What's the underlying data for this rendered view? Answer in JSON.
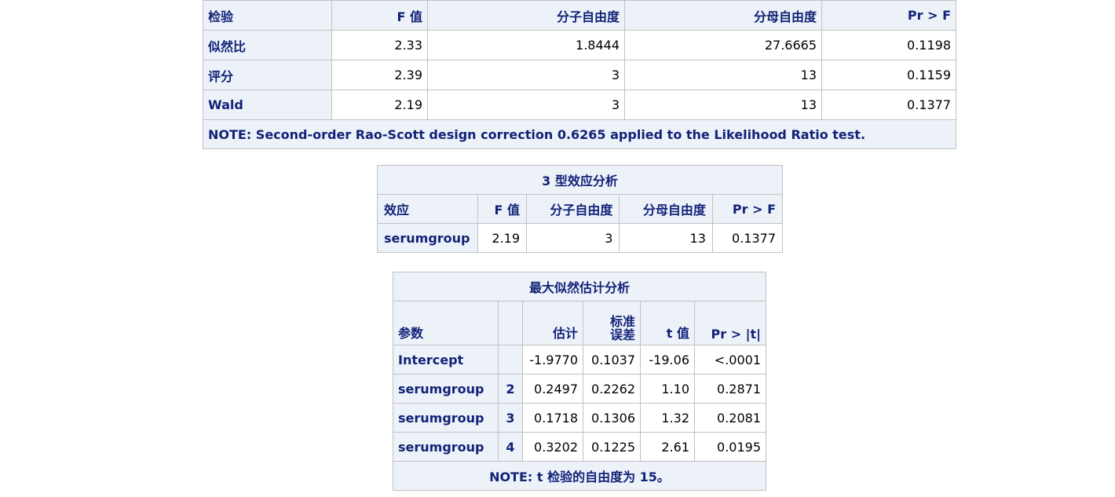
{
  "table_test": {
    "headers": [
      "检验",
      "F 值",
      "分子自由度",
      "分母自由度",
      "Pr > F"
    ],
    "rows": [
      [
        "似然比",
        "2.33",
        "1.8444",
        "27.6665",
        "0.1198"
      ],
      [
        "评分",
        "2.39",
        "3",
        "13",
        "0.1159"
      ],
      [
        "Wald",
        "2.19",
        "3",
        "13",
        "0.1377"
      ]
    ],
    "note": "NOTE: Second-order Rao-Scott design correction 0.6265 applied to the Likelihood Ratio test."
  },
  "table_type3": {
    "title": "3 型效应分析",
    "headers": [
      "效应",
      "F 值",
      "分子自由度",
      "分母自由度",
      "Pr > F"
    ],
    "rows": [
      [
        "serumgroup",
        "2.19",
        "3",
        "13",
        "0.1377"
      ]
    ]
  },
  "table_mle": {
    "title": "最大似然估计分析",
    "headers": [
      "参数",
      "",
      "估计",
      "标准\n误差",
      "t 值",
      "Pr > |t|"
    ],
    "header_se_line1": "标准",
    "header_se_line2": "误差",
    "rows": [
      [
        "Intercept",
        "",
        "-1.9770",
        "0.1037",
        "-19.06",
        "<.0001"
      ],
      [
        "serumgroup",
        "2",
        "0.2497",
        "0.2262",
        "1.10",
        "0.2871"
      ],
      [
        "serumgroup",
        "3",
        "0.1718",
        "0.1306",
        "1.32",
        "0.2081"
      ],
      [
        "serumgroup",
        "4",
        "0.3202",
        "0.1225",
        "2.61",
        "0.0195"
      ]
    ],
    "note": "NOTE: t 检验的自由度为 15。"
  },
  "colors": {
    "header_bg": "#edf2f9",
    "header_text": "#112277",
    "border": "#c1c1c1"
  }
}
